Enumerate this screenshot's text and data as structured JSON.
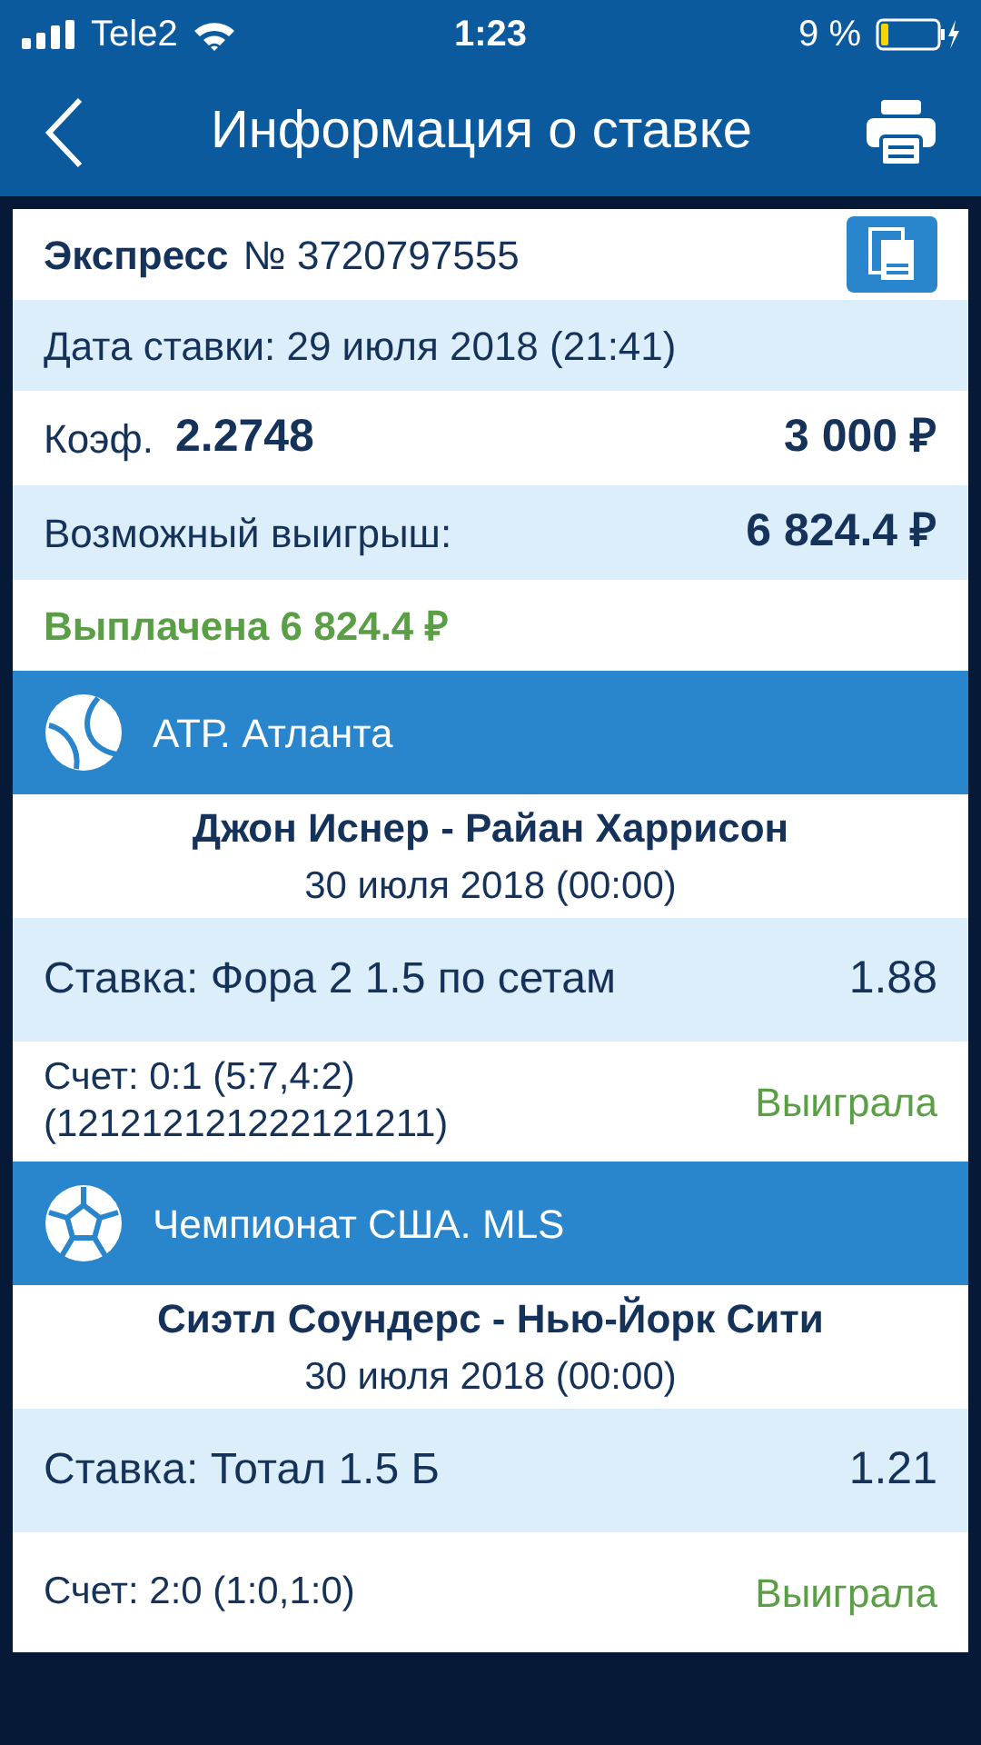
{
  "status_bar": {
    "carrier": "Tele2",
    "time": "1:23",
    "battery": "9 %"
  },
  "nav": {
    "title": "Информация о ставке"
  },
  "bet": {
    "type": "Экспресс",
    "number": "№ 3720797555",
    "date": "Дата ставки: 29 июля 2018 (21:41)",
    "coef_label": "Коэф.",
    "coef": "2.2748",
    "amount": "3 000 ₽",
    "win_label": "Возможный выигрыш:",
    "win": "6 824.4 ₽",
    "paid": "Выплачена 6 824.4 ₽"
  },
  "events": [
    {
      "kind": "tennis",
      "league": "АТР. Атланта",
      "match": "Джон Иснер - Райан Харрисон",
      "date": "30 июля 2018 (00:00)",
      "stake": "Ставка: Фора 2 1.5 по сетам",
      "odds": "1.88",
      "score": [
        "Счет: 0:1 (5:7,4:2)",
        "(121212121222121211)"
      ],
      "result": "Выиграла"
    },
    {
      "kind": "soccer",
      "league": "Чемпионат США. MLS",
      "match": "Сиэтл Соундерс - Нью-Йорк Сити",
      "date": "30 июля 2018 (00:00)",
      "stake": "Ставка: Тотал 1.5 Б",
      "odds": "1.21",
      "score": [
        "Счет: 2:0 (1:0,1:0)"
      ],
      "result": "Выиграла"
    }
  ]
}
